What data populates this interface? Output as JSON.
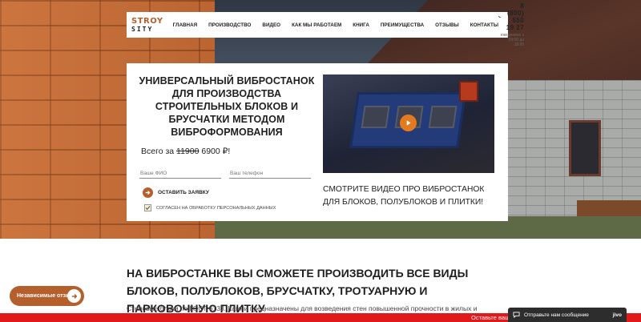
{
  "header": {
    "logo_top": "STROY",
    "logo_bottom": "SITY",
    "nav": [
      "ГЛАВНАЯ",
      "ПРОИЗВОДСТВО",
      "ВИДЕО",
      "КАК МЫ РАБОТАЕМ",
      "КНИГА",
      "ПРЕИМУЩЕСТВА",
      "ОТЗЫВЫ",
      "КОНТАКТЫ"
    ],
    "phone": "8 (800) 550 19 27",
    "hours": "ежедневно с 09:00 до 18:00"
  },
  "hero": {
    "title": "УНИВЕРСАЛЬНЫЙ ВИБРОСТАНОК ДЛЯ ПРОИЗВОДСТВА СТРОИТЕЛЬНЫХ БЛОКОВ И БРУСЧАТКИ МЕТОДОМ ВИБРОФОРМОВАНИЯ",
    "price_prefix": "Всего за",
    "price_old": "11900",
    "price_new": "6900 ₽!",
    "name_placeholder": "Ваше ФИО",
    "phone_placeholder": "Ваш телефон",
    "submit_label": "ОСТАВИТЬ ЗАЯВКУ",
    "consent_label": "СОГЛАСЕН НА ОБРАБОТКУ ПЕРСОНАЛЬНЫХ ДАННЫХ",
    "consent_checked": true,
    "video_caption": "СМОТРИТЕ ВИДЕО ПРО ВИБРОСТАНОК ДЛЯ БЛОКОВ, ПОЛУБЛОКОВ И ПЛИТКИ!"
  },
  "section": {
    "title": "НА ВИБРОСТАНКЕ ВЫ СМОЖЕТЕ ПРОИЗВОДИТЬ ВСЕ ВИДЫ БЛОКОВ, ПОЛУБЛОКОВ, БРУСЧАТКУ, ТРОТУАРНУЮ И ПАРКОВОЧНУЮ ПЛИТКУ",
    "text": "Стеновые блоки по ГОСТ 6133. Камни предназначены для возведения стен повышенной прочности в жилых и"
  },
  "widgets": {
    "reviews_label": "Независимые отзывы",
    "ticker_text": "Оставьте ваш ге",
    "chat_label": "Отправьте нам сообщение",
    "chat_brand": "jivo"
  },
  "colors": {
    "accent": "#b5602c",
    "play": "#e47a1f",
    "ticker": "#e01a1a",
    "chat": "#2d2d2d"
  }
}
